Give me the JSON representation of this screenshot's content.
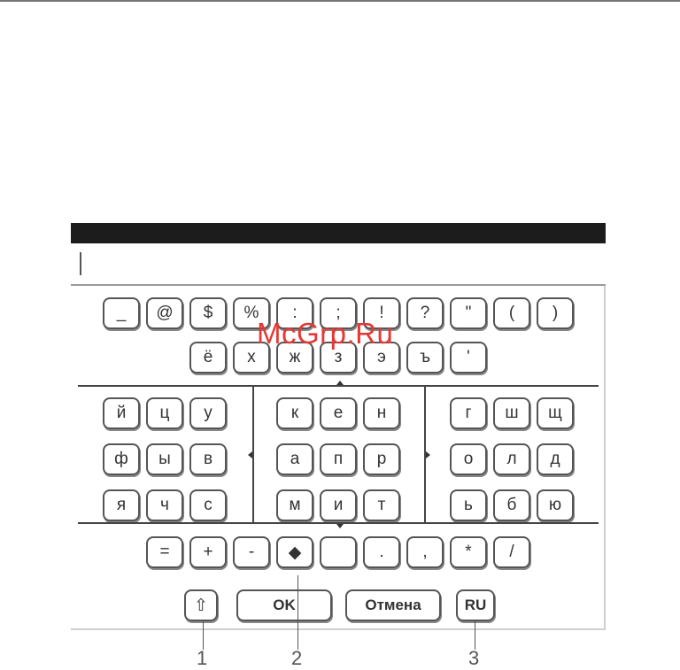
{
  "keyboard": {
    "row_symbols": [
      "_",
      "@",
      "$",
      "%",
      ":",
      ";",
      "!",
      "?",
      "\"",
      "(",
      ")"
    ],
    "row_extra": [
      "ё",
      "х",
      "ж",
      "з",
      "э",
      "ъ",
      "'"
    ],
    "left_block": [
      [
        "й",
        "ц",
        "у"
      ],
      [
        "ф",
        "ы",
        "в"
      ],
      [
        "я",
        "ч",
        "с"
      ]
    ],
    "center_block": [
      [
        "к",
        "е",
        "н"
      ],
      [
        "а",
        "п",
        "р"
      ],
      [
        "м",
        "и",
        "т"
      ]
    ],
    "right_block": [
      [
        "г",
        "ш",
        "щ"
      ],
      [
        "о",
        "л",
        "д"
      ],
      [
        "ь",
        "б",
        "ю"
      ]
    ],
    "row_operators": [
      "=",
      "+",
      "-",
      "backspace",
      "space",
      ".",
      ",",
      "*",
      "/"
    ],
    "backspace_glyph": "◆",
    "shift_glyph": "⇧",
    "ok_label": "OK",
    "cancel_label": "Отмена",
    "lang_label": "RU"
  },
  "callouts": [
    "1",
    "2",
    "3"
  ],
  "watermark": "McGrp.Ru"
}
